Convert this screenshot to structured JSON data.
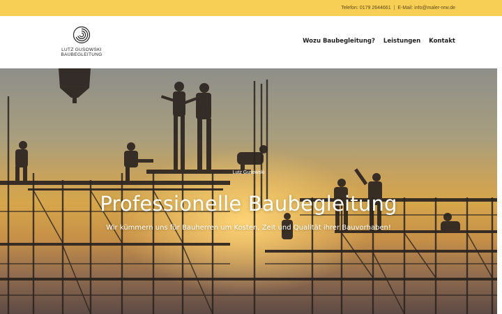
{
  "topbar": {
    "phone": "Telefon: 0179 2644661",
    "separator": "|",
    "email": "E-Mail: info@maler-nrw.de"
  },
  "logo": {
    "icon": "spiral-icon",
    "line1": "LUTZ GUSOWSKI",
    "line2": "BAUBEGLEITUNG"
  },
  "nav": {
    "items": [
      {
        "label": "Wozu Baubegleitung?"
      },
      {
        "label": "Leistungen"
      },
      {
        "label": "Kontakt"
      }
    ]
  },
  "hero": {
    "kicker": "Lutz Gusowski",
    "headline": "Professionelle Baubegleitung",
    "subline": "Wir kümmern uns für Bauherren um Kosten, Zeit und Qualität ihrer Bauvorhaben!"
  },
  "colors": {
    "topbar": "#f8cf55",
    "nav_text": "#1e1e1e",
    "hero_text": "#ffffff"
  }
}
